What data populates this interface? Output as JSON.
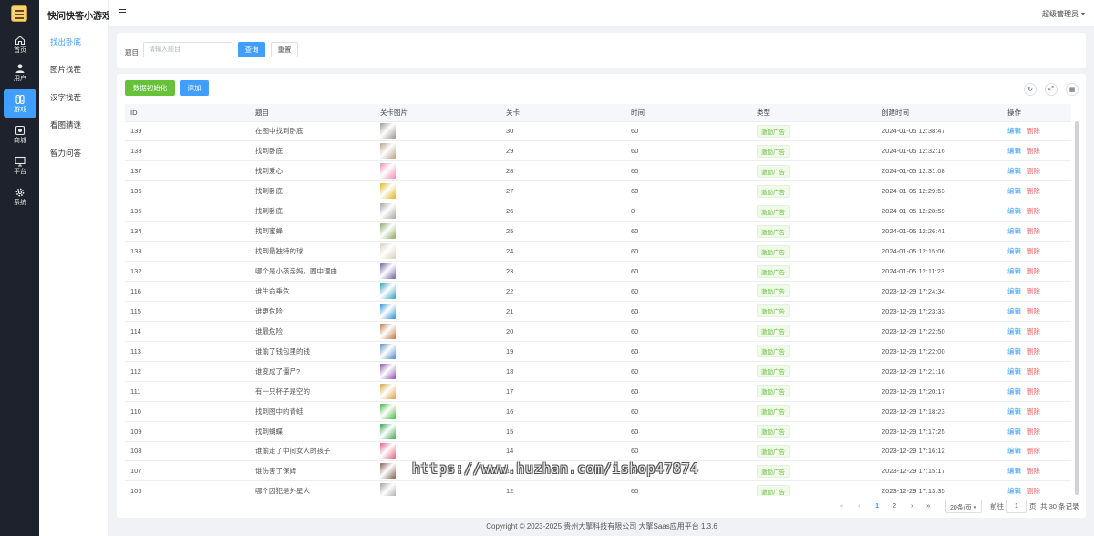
{
  "rail": {
    "items": [
      {
        "label": "首页",
        "icon": "home-icon"
      },
      {
        "label": "用户",
        "icon": "user-icon"
      },
      {
        "label": "游戏",
        "icon": "game-icon",
        "active": true
      },
      {
        "label": "商城",
        "icon": "shop-icon"
      },
      {
        "label": "平台",
        "icon": "monitor-icon"
      },
      {
        "label": "系统",
        "icon": "gear-icon"
      }
    ]
  },
  "subnav": {
    "title": "快问快答小游戏",
    "items": [
      "找出卧底",
      "图片找茬",
      "汉字找茬",
      "看图猜谜",
      "智力问答"
    ]
  },
  "header": {
    "user": "超级管理员"
  },
  "search": {
    "label": "题目",
    "placeholder": "请输入题目",
    "search_btn": "查询",
    "reset_btn": "重置"
  },
  "actions": {
    "init_btn": "数据初始化",
    "add_btn": "添加"
  },
  "table": {
    "columns": [
      "ID",
      "题目",
      "关卡图片",
      "关卡",
      "时间",
      "类型",
      "创建时间",
      "操作"
    ],
    "type_tag": "激励广告",
    "edit": "编辑",
    "delete": "删除",
    "rows": [
      {
        "id": "139",
        "title": "在图中找到卧底",
        "level": "30",
        "time": "60",
        "created": "2024-01-05 12:38:47",
        "thumb": "#9b9590"
      },
      {
        "id": "138",
        "title": "找到卧底",
        "level": "29",
        "time": "60",
        "created": "2024-01-05 12:32:16",
        "thumb": "#b8a288"
      },
      {
        "id": "137",
        "title": "找到爱心",
        "level": "28",
        "time": "60",
        "created": "2024-01-05 12:31:08",
        "thumb": "#f08cb4"
      },
      {
        "id": "136",
        "title": "找到卧底",
        "level": "27",
        "time": "60",
        "created": "2024-01-05 12:29:53",
        "thumb": "#e0b418"
      },
      {
        "id": "135",
        "title": "找到卧底",
        "level": "26",
        "time": "0",
        "created": "2024-01-05 12:28:59",
        "thumb": "#a8a4a0"
      },
      {
        "id": "134",
        "title": "找到蜜蜂",
        "level": "25",
        "time": "60",
        "created": "2024-01-05 12:26:41",
        "thumb": "#8aa860"
      },
      {
        "id": "133",
        "title": "找到最独特的球",
        "level": "24",
        "time": "60",
        "created": "2024-01-05 12:15:06",
        "thumb": "#d8d0b8"
      },
      {
        "id": "132",
        "title": "哪个是小孩亲妈，圈中理由",
        "level": "23",
        "time": "60",
        "created": "2024-01-05 12:11:23",
        "thumb": "#7060a0"
      },
      {
        "id": "116",
        "title": "谁生命垂危",
        "level": "22",
        "time": "60",
        "created": "2023-12-29 17:24:34",
        "thumb": "#30a0c0"
      },
      {
        "id": "115",
        "title": "谁更危险",
        "level": "21",
        "time": "60",
        "created": "2023-12-29 17:23:33",
        "thumb": "#2890d0"
      },
      {
        "id": "114",
        "title": "谁最危险",
        "level": "20",
        "time": "60",
        "created": "2023-12-29 17:22:50",
        "thumb": "#c07840"
      },
      {
        "id": "113",
        "title": "谁偷了钱包里的钱",
        "level": "19",
        "time": "60",
        "created": "2023-12-29 17:22:00",
        "thumb": "#5088c0"
      },
      {
        "id": "112",
        "title": "谁变成了僵尸?",
        "level": "18",
        "time": "60",
        "created": "2023-12-29 17:21:16",
        "thumb": "#9050b0"
      },
      {
        "id": "111",
        "title": "有一只杯子是空的",
        "level": "17",
        "time": "60",
        "created": "2023-12-29 17:20:17",
        "thumb": "#d8a040"
      },
      {
        "id": "110",
        "title": "找到图中的青蛙",
        "level": "16",
        "time": "60",
        "created": "2023-12-29 17:18:23",
        "thumb": "#40b840"
      },
      {
        "id": "109",
        "title": "找到蝴蝶",
        "level": "15",
        "time": "60",
        "created": "2023-12-29 17:17:25",
        "thumb": "#38a050"
      },
      {
        "id": "108",
        "title": "谁偷走了中间女人的孩子",
        "level": "14",
        "time": "60",
        "created": "2023-12-29 17:16:12",
        "thumb": "#e06080"
      },
      {
        "id": "107",
        "title": "谁伤害了保姆",
        "level": "13",
        "time": "60",
        "created": "2023-12-29 17:15:17",
        "thumb": "#806050"
      },
      {
        "id": "106",
        "title": "哪个囚犯是外星人",
        "level": "12",
        "time": "60",
        "created": "2023-12-29 17:13:35",
        "thumb": "#a0a0a0"
      }
    ]
  },
  "pager": {
    "pages": [
      "1",
      "2"
    ],
    "current": "1",
    "page_size": "20条/页",
    "goto_label": "前往",
    "goto_value": "1",
    "page_unit": "页",
    "total": "共 30 条记录"
  },
  "footer": "Copyright © 2023-2025 贵州大擎科技有限公司  大擎Saas应用平台 1.3.6",
  "watermark": "https://www.huzhan.com/ishop47874"
}
